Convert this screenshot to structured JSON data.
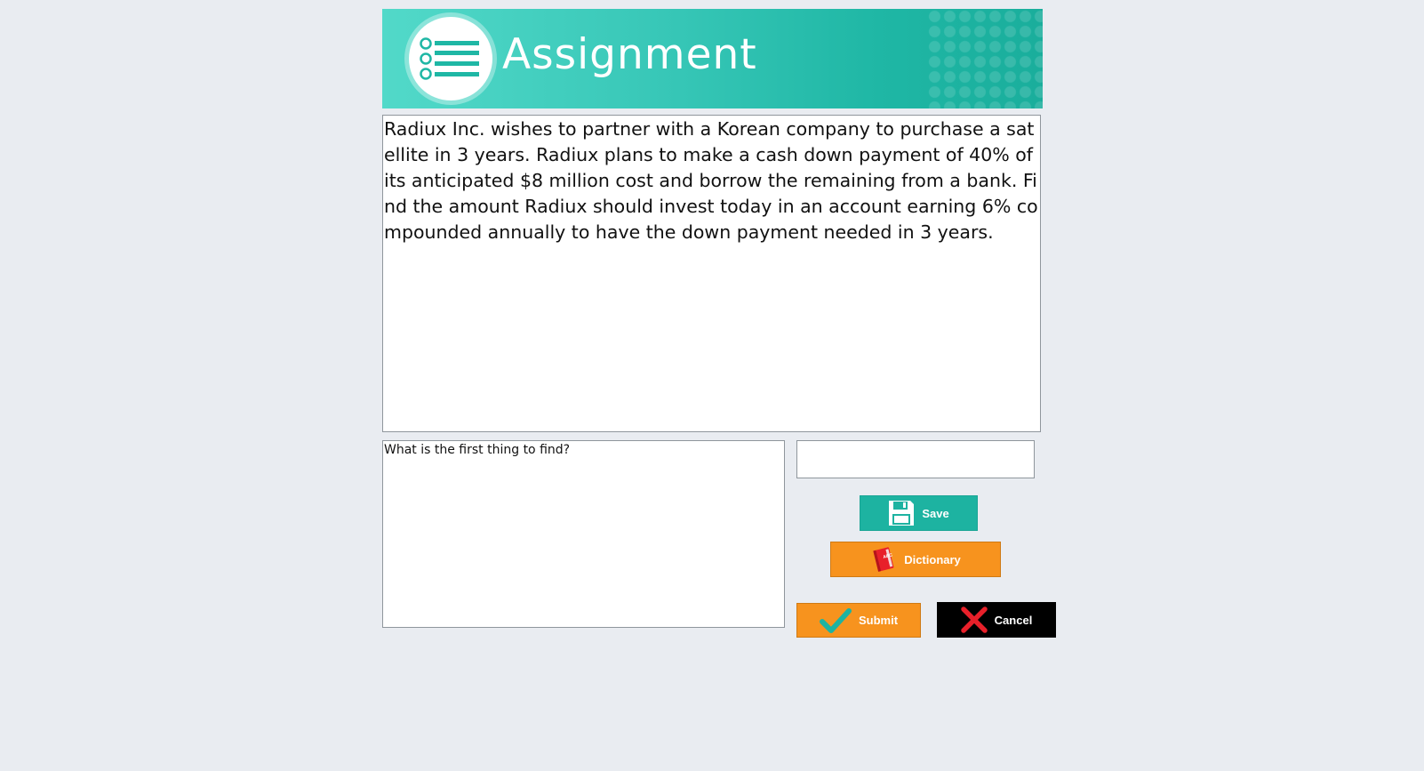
{
  "header": {
    "title": "Assignment",
    "icon": "list-icon"
  },
  "question": {
    "text": "Radiux Inc. wishes to partner with a Korean company to purchase a satellite in 3 years. Radiux plans to make a cash down payment of 40% of its anticipated $8 million cost and borrow the remaining from a bank. Find the amount Radiux should invest today in an account earning 6% compounded annually to have the down payment needed in 3 years."
  },
  "answer": {
    "prompt": "What is the first thing to find?"
  },
  "input": {
    "value": ""
  },
  "buttons": {
    "save": {
      "label": "Save",
      "icon": "floppy-disk-icon"
    },
    "dictionary": {
      "label": "Dictionary",
      "icon": "dictionary-book-icon"
    },
    "submit": {
      "label": "Submit",
      "icon": "checkmark-icon"
    },
    "cancel": {
      "label": "Cancel",
      "icon": "x-icon"
    }
  },
  "colors": {
    "header_gradient_start": "#52d9c9",
    "header_gradient_end": "#1aae9c",
    "save": "#1db3a1",
    "orange": "#f7931e",
    "cancel": "#000000",
    "check": "#1db3a1",
    "x": "#e8202a"
  }
}
